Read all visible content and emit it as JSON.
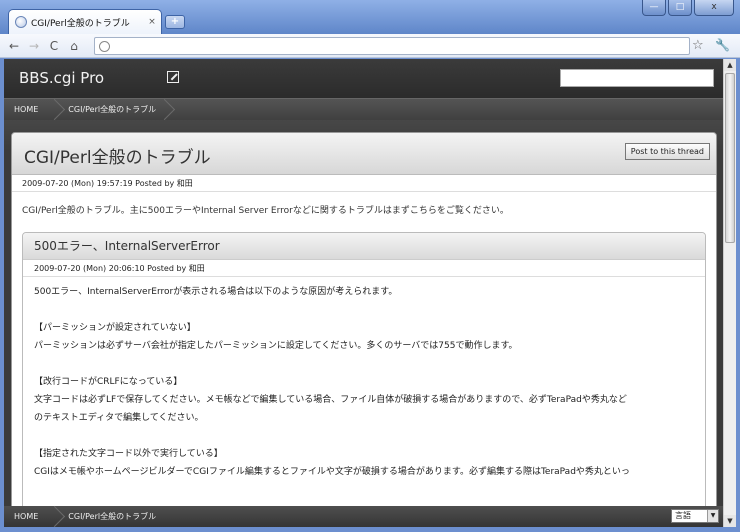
{
  "browser": {
    "tab_title": "CGI/Perl全般のトラブル",
    "tab_close": "×",
    "new_tab": "+",
    "win_min": "—",
    "win_max": "□",
    "win_close": "x",
    "back": "←",
    "forward": "→",
    "reload": "C",
    "home": "⌂",
    "star": "☆",
    "wrench": "🔧"
  },
  "site": {
    "title": "BBS.cgi Pro",
    "breadcrumb": [
      "HOME",
      "CGI/Perl全般のトラブル"
    ]
  },
  "thread": {
    "title": "CGI/Perl全般のトラブル",
    "post_button": "Post to this thread",
    "meta": "2009-07-20 (Mon) 19:57:19 Posted by 和田",
    "description": "CGI/Perl全般のトラブル。主に500エラーやInternal Server Errorなどに関するトラブルはまずこちらをご覧ください。"
  },
  "reply": {
    "title": "500エラー、InternalServerError",
    "meta": "2009-07-20 (Mon) 20:06:10 Posted by 和田",
    "lines": {
      "l1": "500エラー、InternalServerErrorが表示される場合は以下のような原因が考えられます。",
      "l2": "【パーミッションが設定されていない】",
      "l3": "パーミッションは必ずサーバ会社が指定したパーミッションに設定してください。多くのサーバでは755で動作します。",
      "l4": "【改行コードがCRLFになっている】",
      "l5": "文字コードは必ずLFで保存してください。メモ帳などで編集している場合、ファイル自体が破損する場合がありますので、必ずTeraPadや秀丸など",
      "l6": "のテキストエディタで編集してください。",
      "l7": "【指定された文字コード以外で実行している】",
      "l8": "CGIはメモ帳やホームページビルダーでCGIファイル編集するとファイルや文字が破損する場合があります。必ず編集する際はTeraPadや秀丸といっ"
    }
  },
  "footer": {
    "breadcrumb": [
      "HOME",
      "CGI/Perl全般のトラブル"
    ],
    "language": "言語",
    "language_arrow": "▼"
  },
  "scroll": {
    "up": "▲",
    "down": "▼"
  }
}
